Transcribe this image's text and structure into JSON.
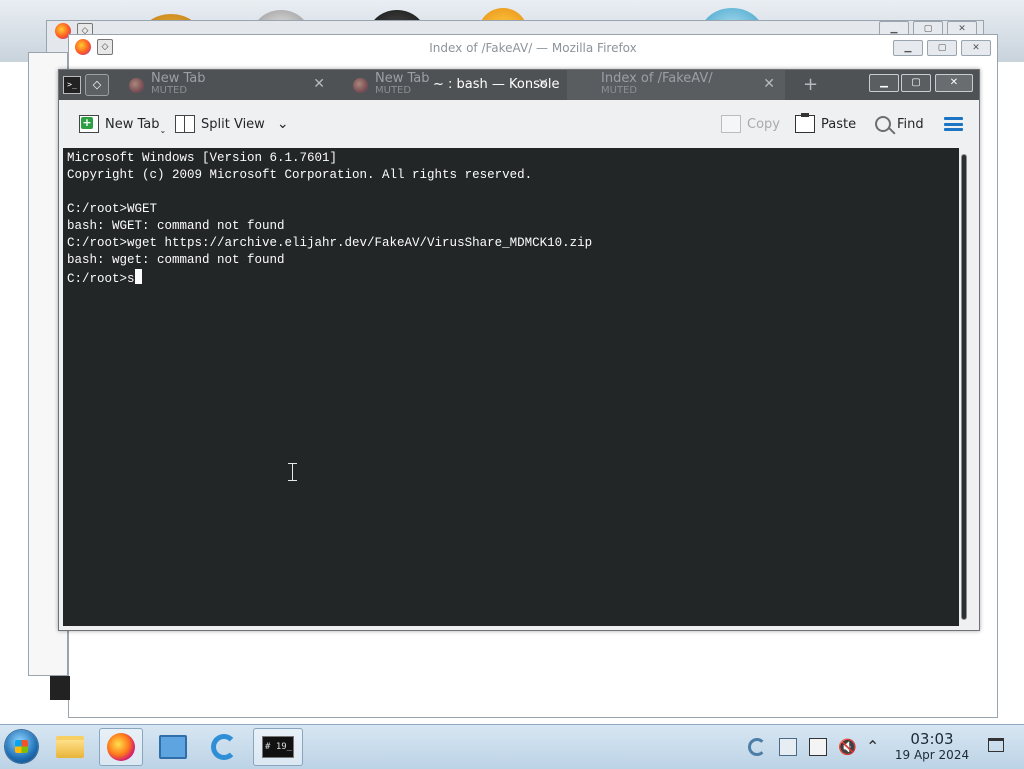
{
  "background": {
    "firefox_window_title": "Index of /FakeAV/ — Mozilla Firefox",
    "window_buttons": [
      "▁",
      "▢",
      "✕"
    ]
  },
  "konsole": {
    "window_title": "~ : bash — Konsole",
    "tabs": [
      {
        "name": "New Tab",
        "sub": "MUTED"
      },
      {
        "name": "New Tab",
        "sub": "MUTED"
      },
      {
        "name": "Index of /FakeAV/",
        "sub": "MUTED"
      }
    ],
    "new_tab_plus": "+",
    "toolbar": {
      "new_tab": "New Tab",
      "split_view": "Split View",
      "copy": "Copy",
      "paste": "Paste",
      "find": "Find"
    },
    "terminal": {
      "lines": [
        "Microsoft Windows [Version 6.1.7601]",
        "Copyright (c) 2009 Microsoft Corporation. All rights reserved.",
        "",
        "C:/root>WGET",
        "bash: WGET: command not found",
        "C:/root>wget https://archive.elijahr.dev/FakeAV/VirusShare_MDMCK10.zip",
        "bash: wget: command not found"
      ],
      "prompt_line": "C:/root>s"
    },
    "colors": {
      "terminal_bg": "#232627",
      "terminal_fg": "#fcfcfc",
      "titlebar": "#4f5254",
      "accent": "#1d74c5"
    }
  },
  "taskbar": {
    "clock_time": "03:03",
    "clock_date": "19 Apr 2024",
    "terminal_thumb": "# 19_"
  }
}
